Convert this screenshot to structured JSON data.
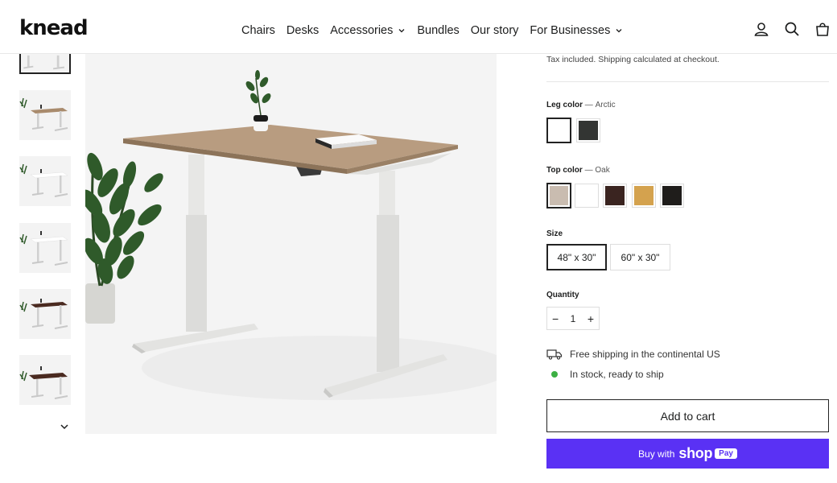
{
  "brand": {
    "logo_text": "knead"
  },
  "nav": {
    "items": [
      {
        "label": "Chairs",
        "has_dropdown": false
      },
      {
        "label": "Desks",
        "has_dropdown": false
      },
      {
        "label": "Accessories",
        "has_dropdown": true
      },
      {
        "label": "Bundles",
        "has_dropdown": false
      },
      {
        "label": "Our story",
        "has_dropdown": false
      },
      {
        "label": "For Businesses",
        "has_dropdown": true
      }
    ]
  },
  "header_icons": [
    "user-icon",
    "search-icon",
    "cart-icon"
  ],
  "gallery": {
    "thumbnails": [
      {
        "top_color": "#ffffff",
        "active": true
      },
      {
        "top_color": "#a98b6d"
      },
      {
        "top_color": "#ffffff"
      },
      {
        "top_color": "#ffffff"
      },
      {
        "top_color": "#4a2a20"
      },
      {
        "top_color": "#4a2a20"
      }
    ]
  },
  "product": {
    "tax_note": "Tax included. Shipping calculated at checkout.",
    "leg_color": {
      "label": "Leg color",
      "separator": "—",
      "selected": "Arctic",
      "swatches": [
        {
          "name": "Arctic",
          "color": "#ffffff",
          "selected": true
        },
        {
          "name": "Black",
          "color": "#333533",
          "selected": false
        }
      ]
    },
    "top_color": {
      "label": "Top color",
      "separator": "—",
      "selected": "Oak",
      "swatches": [
        {
          "name": "Oak",
          "color": "#c9bcb0",
          "selected": true
        },
        {
          "name": "White",
          "color": "#ffffff",
          "selected": false
        },
        {
          "name": "Walnut",
          "color": "#3a2420",
          "selected": false
        },
        {
          "name": "Bamboo",
          "color": "#d4a24e",
          "selected": false
        },
        {
          "name": "Black",
          "color": "#1f1d1b",
          "selected": false
        }
      ]
    },
    "size": {
      "label": "Size",
      "options": [
        {
          "label": "48\" x 30\"",
          "selected": true
        },
        {
          "label": "60\" x 30\"",
          "selected": false
        }
      ]
    },
    "quantity": {
      "label": "Quantity",
      "value": "1",
      "minus": "−",
      "plus": "+"
    },
    "shipping_note": "Free shipping in the continental US",
    "stock_note": "In stock, ready to ship",
    "add_to_cart": "Add to cart",
    "buy_with": {
      "prefix": "Buy with",
      "brand": "shop",
      "pill": "Pay"
    }
  },
  "colors": {
    "accent_purple": "#5a31f4",
    "stock_green": "#3cb043"
  }
}
